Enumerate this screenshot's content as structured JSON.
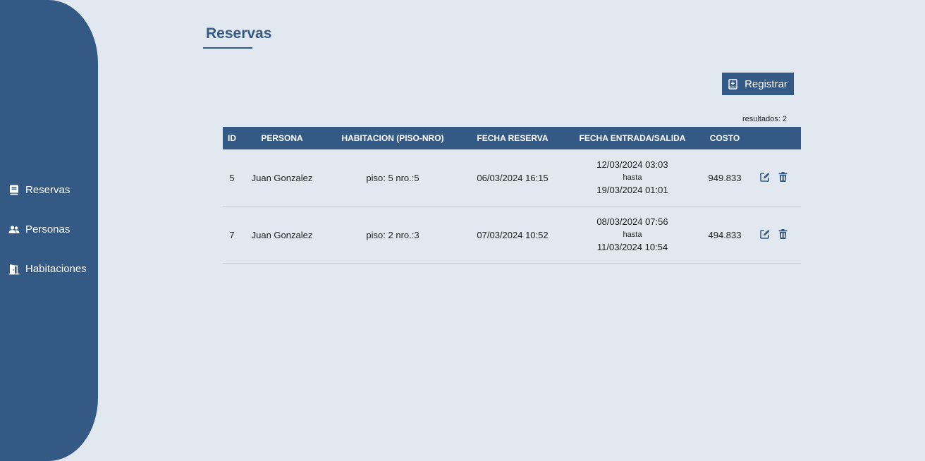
{
  "sidebar": {
    "items": [
      {
        "label": "Reservas",
        "icon": "book-icon"
      },
      {
        "label": "Personas",
        "icon": "users-icon"
      },
      {
        "label": "Habitaciones",
        "icon": "door-icon"
      }
    ]
  },
  "main": {
    "title": "Reservas",
    "register_label": "Registrar",
    "results_text": "resultados: 2"
  },
  "table": {
    "columns": [
      "ID",
      "PERSONA",
      "HABITACION (PISO-NRO)",
      "FECHA RESERVA",
      "FECHA ENTRADA/SALIDA",
      "COSTO"
    ],
    "rows": [
      {
        "id": "5",
        "persona": "Juan Gonzalez",
        "habitacion": "piso: 5 nro.:5",
        "fecha_reserva": "06/03/2024 16:15",
        "entrada": "12/03/2024 03:03",
        "hasta": "hasta",
        "salida": "19/03/2024 01:01",
        "costo": "949.833"
      },
      {
        "id": "7",
        "persona": "Juan Gonzalez",
        "habitacion": "piso: 2 nro.:3",
        "fecha_reserva": "07/03/2024 10:52",
        "entrada": "08/03/2024 07:56",
        "hasta": "hasta",
        "salida": "11/03/2024 10:54",
        "costo": "494.833"
      }
    ]
  },
  "colors": {
    "primary": "#355985",
    "background": "#e1e8f0"
  }
}
